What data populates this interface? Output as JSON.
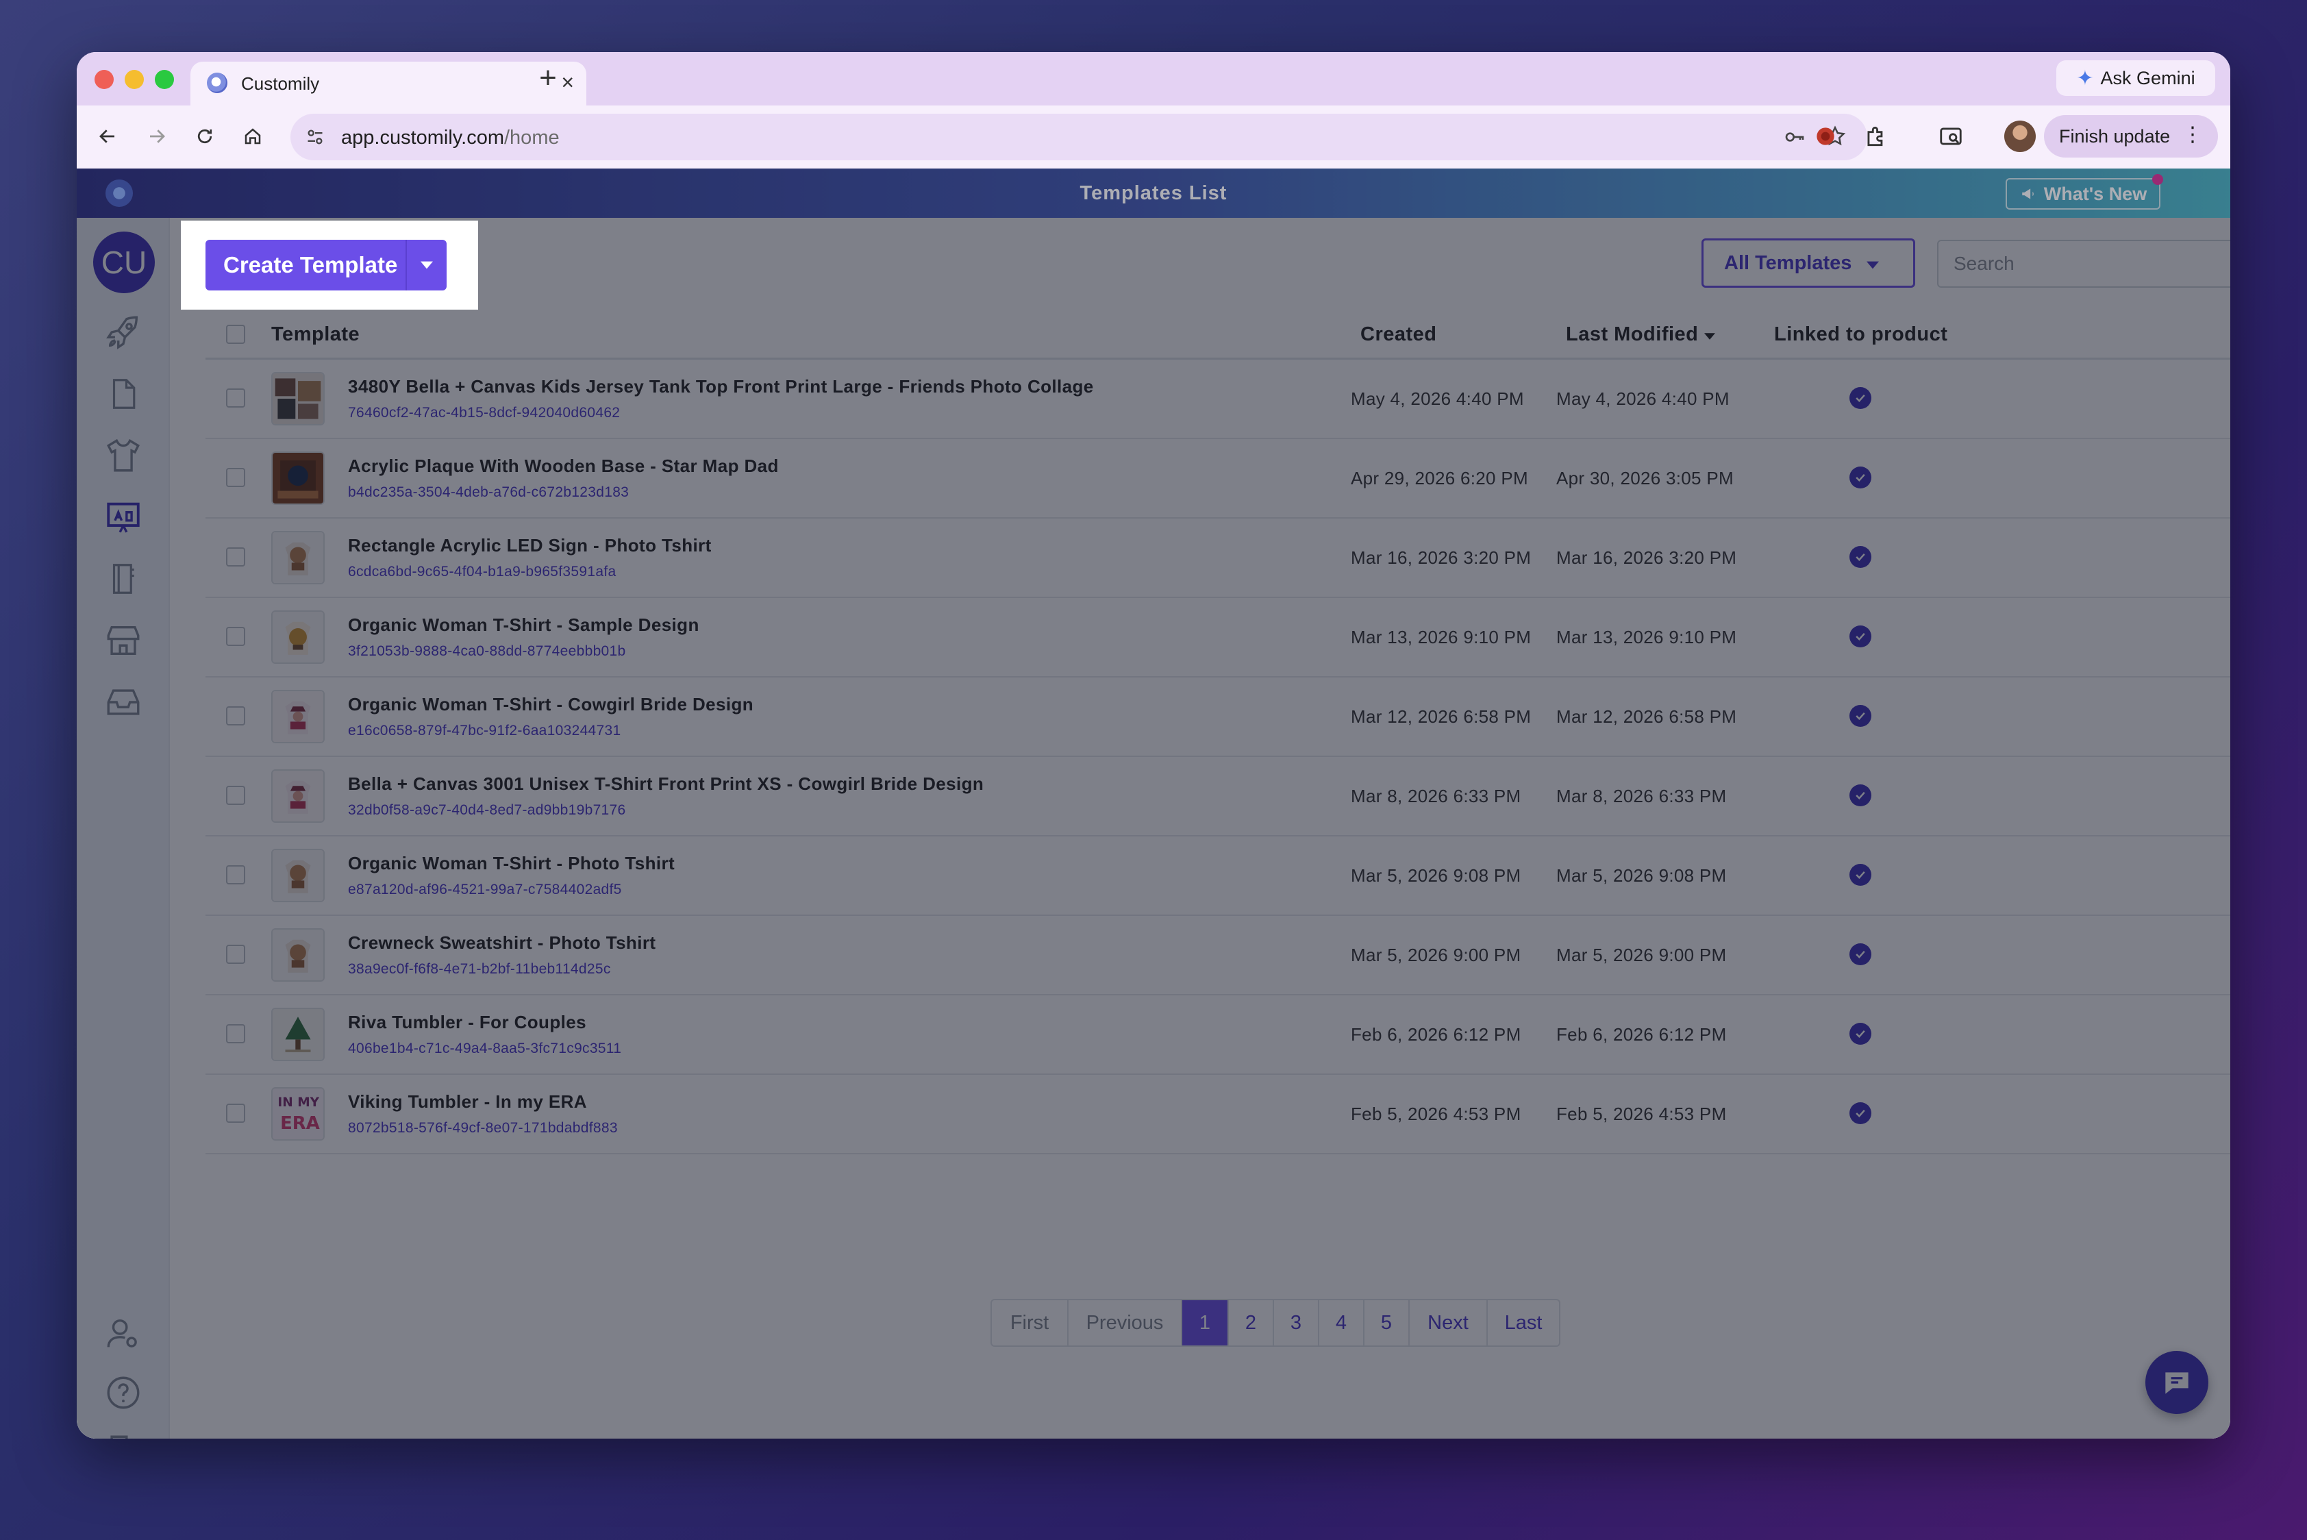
{
  "browser": {
    "tab_title": "Customily",
    "tab_close": "×",
    "new_tab": "+",
    "ask_gemini": "Ask Gemini",
    "url_host": "app.customily.com",
    "url_path": "/home",
    "finish_update": "Finish update"
  },
  "app": {
    "header_title": "Templates List",
    "whats_new": "What's New",
    "avatar_initials": "CU"
  },
  "toolbar": {
    "create_label": "Create Template",
    "filter_label": "All Templates",
    "search_placeholder": "Search"
  },
  "table": {
    "columns": {
      "template": "Template",
      "created": "Created",
      "modified": "Last Modified",
      "linked": "Linked to product"
    },
    "rows": [
      {
        "name": "3480Y Bella + Canvas Kids Jersey Tank Top Front Print Large - Friends Photo Collage",
        "id": "76460cf2-47ac-4b15-8dcf-942040d60462",
        "created": "May 4, 2026 4:40 PM",
        "modified": "May 4, 2026 4:40 PM",
        "thumb": "collage"
      },
      {
        "name": "Acrylic Plaque With Wooden Base - Star Map Dad",
        "id": "b4dc235a-3504-4deb-a76d-c672b123d183",
        "created": "Apr 29, 2026 6:20 PM",
        "modified": "Apr 30, 2026 3:05 PM",
        "thumb": "plaque"
      },
      {
        "name": "Rectangle Acrylic LED Sign - Photo Tshirt",
        "id": "6cdca6bd-9c65-4f04-b1a9-b965f3591afa",
        "created": "Mar 16, 2026 3:20 PM",
        "modified": "Mar 16, 2026 3:20 PM",
        "thumb": "photo"
      },
      {
        "name": "Organic Woman T-Shirt - Sample Design",
        "id": "3f21053b-9888-4ca0-88dd-8774eebbb01b",
        "created": "Mar 13, 2026 9:10 PM",
        "modified": "Mar 13, 2026 9:10 PM",
        "thumb": "sample"
      },
      {
        "name": "Organic Woman T-Shirt - Cowgirl Bride Design",
        "id": "e16c0658-879f-47bc-91f2-6aa103244731",
        "created": "Mar 12, 2026 6:58 PM",
        "modified": "Mar 12, 2026 6:58 PM",
        "thumb": "cowgirl"
      },
      {
        "name": "Bella + Canvas 3001 Unisex T-Shirt Front Print XS - Cowgirl Bride Design",
        "id": "32db0f58-a9c7-40d4-8ed7-ad9bb19b7176",
        "created": "Mar 8, 2026 6:33 PM",
        "modified": "Mar 8, 2026 6:33 PM",
        "thumb": "cowgirl"
      },
      {
        "name": "Organic Woman T-Shirt - Photo Tshirt",
        "id": "e87a120d-af96-4521-99a7-c7584402adf5",
        "created": "Mar 5, 2026 9:08 PM",
        "modified": "Mar 5, 2026 9:08 PM",
        "thumb": "photo"
      },
      {
        "name": "Crewneck Sweatshirt - Photo Tshirt",
        "id": "38a9ec0f-f6f8-4e71-b2bf-11beb114d25c",
        "created": "Mar 5, 2026 9:00 PM",
        "modified": "Mar 5, 2026 9:00 PM",
        "thumb": "photo"
      },
      {
        "name": "Riva Tumbler - For Couples",
        "id": "406be1b4-c71c-49a4-8aa5-3fc71c9c3511",
        "created": "Feb 6, 2026 6:12 PM",
        "modified": "Feb 6, 2026 6:12 PM",
        "thumb": "tree"
      },
      {
        "name": "Viking Tumbler - In my ERA",
        "id": "8072b518-576f-49cf-8e07-171bdabdf883",
        "created": "Feb 5, 2026 4:53 PM",
        "modified": "Feb 5, 2026 4:53 PM",
        "thumb": "era"
      }
    ]
  },
  "pagination": {
    "first": "First",
    "previous": "Previous",
    "pages": [
      "1",
      "2",
      "3",
      "4",
      "5"
    ],
    "active_page": "1",
    "next": "Next",
    "last": "Last"
  },
  "colors": {
    "accent": "#6b4ee8",
    "brand_dark": "#3d2fb5",
    "header_start": "#2c2f7c",
    "header_end": "#4db7c6"
  },
  "icons": {
    "sidebar": [
      "rocket-icon",
      "document-icon",
      "tshirt-icon",
      "design-board-icon",
      "notebook-icon",
      "store-icon",
      "inbox-icon",
      "user-settings-icon",
      "help-icon",
      "logout-icon"
    ],
    "row_linked": "check-circle-icon",
    "chat": "chat-icon"
  }
}
